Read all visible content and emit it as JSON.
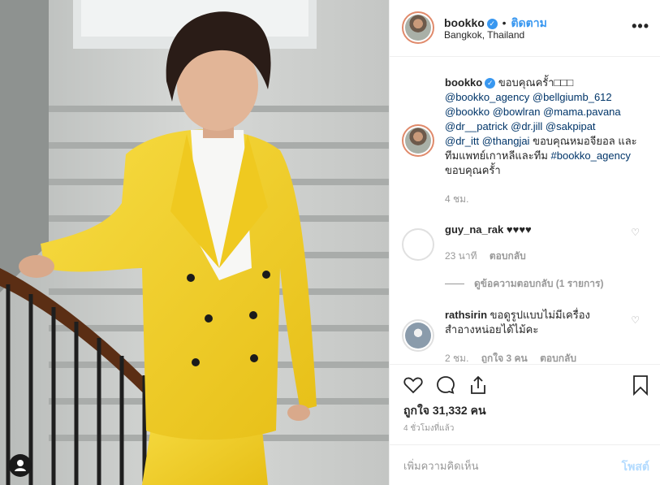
{
  "post": {
    "image_alt": "woman in yellow suit on stairs"
  },
  "header": {
    "username": "bookko",
    "verified_mark": "✓",
    "separator": "•",
    "follow_label": "ติดตาม",
    "location": "Bangkok, Thailand",
    "more_label": "•••"
  },
  "caption": {
    "username": "bookko",
    "verified_mark": "✓",
    "text_start": "ขอบคุณครั้า□□□",
    "mentions_1": "@bookko_agency @bellgiumb_612",
    "mentions_2": "@bookko @bowlran @mama.pavana",
    "mentions_3": "@dr__patrick @dr.jill @sakpipat",
    "mention_4": "@dr_itt @thangjai",
    "text_mid": " ขอบคุณหมอจียอล และทีมแพทย์เกาหลีและทีม ",
    "hashtag": "#bookko_agency",
    "text_end": " ขอบคุณครั้า",
    "time": "4 ชม."
  },
  "comments": [
    {
      "username": "guy_na_rak",
      "text": "♥♥♥♥",
      "time": "23 นาที",
      "reply_label": "ตอบกลับ",
      "view_replies": "ดูข้อความตอบกลับ (1 รายการ)"
    },
    {
      "username": "rathsirin",
      "text": "ขอดูรูปแบบไม่มีเครื่องสำอางหน่อยได้ไม้คะ",
      "time": "2 ชม.",
      "likes": "ถูกใจ 3 คน",
      "reply_label": "ตอบกลับ"
    }
  ],
  "actions": {
    "likes_text": "ถูกใจ 31,332 คน",
    "post_time": "4 ชั่วโมงที่แล้ว"
  },
  "add_comment": {
    "placeholder": "เพิ่มความคิดเห็น",
    "post_label": "โพสต์"
  },
  "colors": {
    "accent": "#3897f0",
    "suit": "#f2cf2a",
    "muted": "#999999"
  },
  "icons": [
    "heart-icon",
    "comment-icon",
    "share-icon",
    "bookmark-icon",
    "user-tag-icon",
    "verified-icon",
    "more-icon"
  ]
}
